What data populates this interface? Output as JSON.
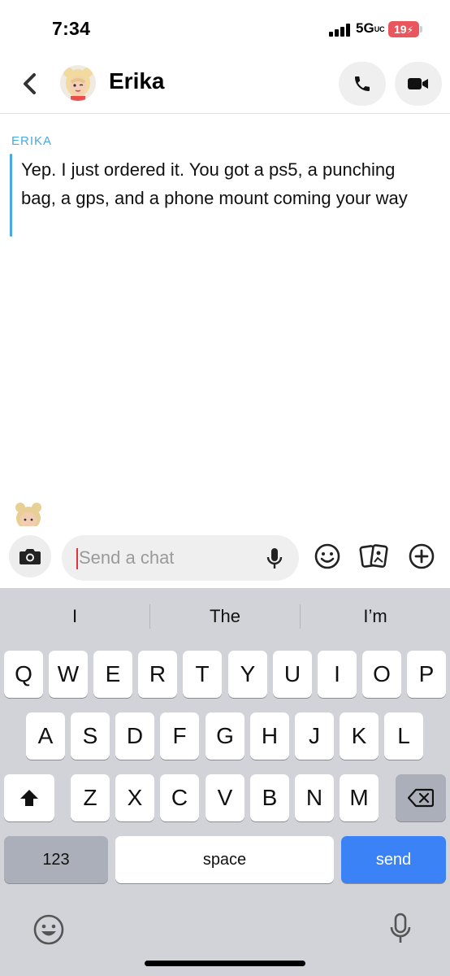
{
  "status_bar": {
    "time": "7:34",
    "network": "5G",
    "network_suffix": "UC",
    "battery": "19"
  },
  "header": {
    "contact_name": "Erika"
  },
  "chat": {
    "messages": [
      {
        "sender": "ERIKA",
        "text": "Yep. I just ordered it. You got a ps5, a punching bag, a gps, and a phone mount coming your way"
      }
    ]
  },
  "input": {
    "placeholder": "Send a chat"
  },
  "keyboard": {
    "suggestions": [
      "I",
      "The",
      "I’m"
    ],
    "row1": [
      "Q",
      "W",
      "E",
      "R",
      "T",
      "Y",
      "U",
      "I",
      "O",
      "P"
    ],
    "row2": [
      "A",
      "S",
      "D",
      "F",
      "G",
      "H",
      "J",
      "K",
      "L"
    ],
    "row3": [
      "Z",
      "X",
      "C",
      "V",
      "B",
      "N",
      "M"
    ],
    "numbers_label": "123",
    "space_label": "space",
    "send_label": "send"
  },
  "colors": {
    "accent_blue": "#4aa8e6",
    "send_key": "#3b82f6",
    "battery": "#e9565e",
    "caret": "#e0353f"
  },
  "icons": [
    "back-icon",
    "phone-icon",
    "video-icon",
    "camera-icon",
    "microphone-icon",
    "smiley-icon",
    "cards-icon",
    "plus-circle-icon",
    "shift-icon",
    "delete-icon",
    "emoji-icon",
    "dictation-icon"
  ]
}
